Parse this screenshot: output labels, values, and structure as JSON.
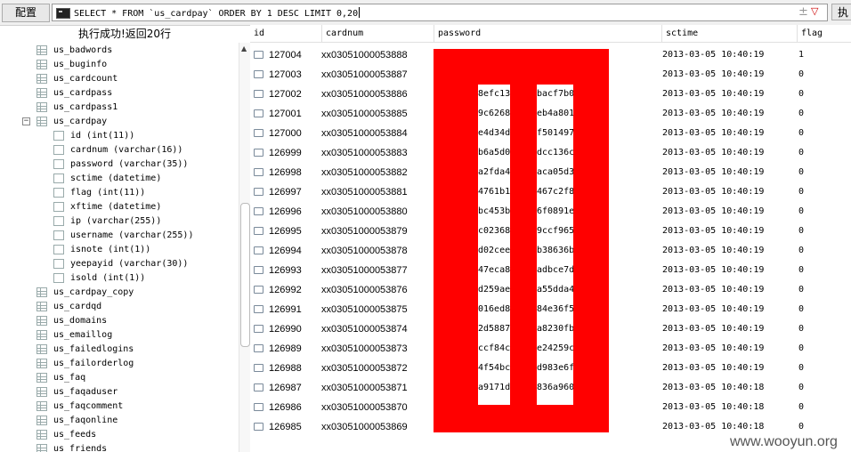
{
  "toolbar": {
    "config_label": "配置",
    "sql_query": "SELECT * FROM `us_cardpay` ORDER BY 1 DESC LIMIT 0,20",
    "execute_label": "执"
  },
  "status_text": "执行成功!返回20行",
  "tree": [
    {
      "type": "table",
      "label": "us_badwords"
    },
    {
      "type": "table",
      "label": "us_buginfo"
    },
    {
      "type": "table",
      "label": "us_cardcount"
    },
    {
      "type": "table",
      "label": "us_cardpass"
    },
    {
      "type": "table",
      "label": "us_cardpass1"
    },
    {
      "type": "table-open",
      "label": "us_cardpay"
    },
    {
      "type": "column",
      "label": "id (int(11))"
    },
    {
      "type": "column",
      "label": "cardnum (varchar(16))"
    },
    {
      "type": "column",
      "label": "password (varchar(35))"
    },
    {
      "type": "column",
      "label": "sctime (datetime)"
    },
    {
      "type": "column",
      "label": "flag (int(11))"
    },
    {
      "type": "column",
      "label": "xftime (datetime)"
    },
    {
      "type": "column",
      "label": "ip (varchar(255))"
    },
    {
      "type": "column",
      "label": "username (varchar(255))"
    },
    {
      "type": "column",
      "label": "isnote (int(1))"
    },
    {
      "type": "column",
      "label": "yeepayid (varchar(30))"
    },
    {
      "type": "column",
      "label": "isold (int(1))"
    },
    {
      "type": "table",
      "label": "us_cardpay_copy"
    },
    {
      "type": "table",
      "label": "us_cardqd"
    },
    {
      "type": "table",
      "label": "us_domains"
    },
    {
      "type": "table",
      "label": "us_emaillog"
    },
    {
      "type": "table",
      "label": "us_failedlogins"
    },
    {
      "type": "table",
      "label": "us_failorderlog"
    },
    {
      "type": "table",
      "label": "us_faq"
    },
    {
      "type": "table",
      "label": "us_faqaduser"
    },
    {
      "type": "table",
      "label": "us_faqcomment"
    },
    {
      "type": "table",
      "label": "us_faqonline"
    },
    {
      "type": "table",
      "label": "us_feeds"
    },
    {
      "type": "table",
      "label": "us_friends"
    }
  ],
  "columns": [
    "id",
    "cardnum",
    "password",
    "sctime",
    "flag"
  ],
  "rows": [
    {
      "id": "127004",
      "cardnum": "xx03051000053888",
      "pw_a": "",
      "pw_b": "",
      "sctime": "2013-03-05 10:40:19",
      "flag": "1"
    },
    {
      "id": "127003",
      "cardnum": "xx03051000053887",
      "pw_a": "",
      "pw_b": "",
      "sctime": "2013-03-05 10:40:19",
      "flag": "0"
    },
    {
      "id": "127002",
      "cardnum": "xx03051000053886",
      "pw_a": "8efc13",
      "pw_b": "bacf7b0",
      "sctime": "2013-03-05 10:40:19",
      "flag": "0"
    },
    {
      "id": "127001",
      "cardnum": "xx03051000053885",
      "pw_a": "9c6268",
      "pw_b": "eb4a801",
      "sctime": "2013-03-05 10:40:19",
      "flag": "0"
    },
    {
      "id": "127000",
      "cardnum": "xx03051000053884",
      "pw_a": "e4d34d",
      "pw_b": "f501497",
      "sctime": "2013-03-05 10:40:19",
      "flag": "0"
    },
    {
      "id": "126999",
      "cardnum": "xx03051000053883",
      "pw_a": "b6a5d0",
      "pw_b": "dcc136c",
      "sctime": "2013-03-05 10:40:19",
      "flag": "0"
    },
    {
      "id": "126998",
      "cardnum": "xx03051000053882",
      "pw_a": "a2fda4",
      "pw_b": "aca05d3",
      "sctime": "2013-03-05 10:40:19",
      "flag": "0"
    },
    {
      "id": "126997",
      "cardnum": "xx03051000053881",
      "pw_a": "4761b1",
      "pw_b": "467c2f8",
      "sctime": "2013-03-05 10:40:19",
      "flag": "0"
    },
    {
      "id": "126996",
      "cardnum": "xx03051000053880",
      "pw_a": "bc453b",
      "pw_b": "6f0891e",
      "sctime": "2013-03-05 10:40:19",
      "flag": "0"
    },
    {
      "id": "126995",
      "cardnum": "xx03051000053879",
      "pw_a": "c02368",
      "pw_b": "9ccf965",
      "sctime": "2013-03-05 10:40:19",
      "flag": "0"
    },
    {
      "id": "126994",
      "cardnum": "xx03051000053878",
      "pw_a": "d02cee",
      "pw_b": "b38636b",
      "sctime": "2013-03-05 10:40:19",
      "flag": "0"
    },
    {
      "id": "126993",
      "cardnum": "xx03051000053877",
      "pw_a": "47eca8",
      "pw_b": "adbce7d",
      "sctime": "2013-03-05 10:40:19",
      "flag": "0"
    },
    {
      "id": "126992",
      "cardnum": "xx03051000053876",
      "pw_a": "d259ae",
      "pw_b": "a55dda4",
      "sctime": "2013-03-05 10:40:19",
      "flag": "0"
    },
    {
      "id": "126991",
      "cardnum": "xx03051000053875",
      "pw_a": "016ed8",
      "pw_b": "84e36f5",
      "sctime": "2013-03-05 10:40:19",
      "flag": "0"
    },
    {
      "id": "126990",
      "cardnum": "xx03051000053874",
      "pw_a": "2d5887",
      "pw_b": "a8230fb",
      "sctime": "2013-03-05 10:40:19",
      "flag": "0"
    },
    {
      "id": "126989",
      "cardnum": "xx03051000053873",
      "pw_a": "ccf84c",
      "pw_b": "e24259c",
      "sctime": "2013-03-05 10:40:19",
      "flag": "0"
    },
    {
      "id": "126988",
      "cardnum": "xx03051000053872",
      "pw_a": "4f54bc",
      "pw_b": "d983e6f",
      "sctime": "2013-03-05 10:40:19",
      "flag": "0"
    },
    {
      "id": "126987",
      "cardnum": "xx03051000053871",
      "pw_a": "a9171d",
      "pw_b": "836a960",
      "sctime": "2013-03-05 10:40:18",
      "flag": "0"
    },
    {
      "id": "126986",
      "cardnum": "xx03051000053870",
      "pw_a": "",
      "pw_b": "",
      "sctime": "2013-03-05 10:40:18",
      "flag": "0"
    },
    {
      "id": "126985",
      "cardnum": "xx03051000053869",
      "pw_a": "",
      "pw_b": "",
      "sctime": "2013-03-05 10:40:18",
      "flag": "0"
    }
  ],
  "watermark": "www.wooyun.org",
  "colors": {
    "redaction": "#ff0000"
  }
}
